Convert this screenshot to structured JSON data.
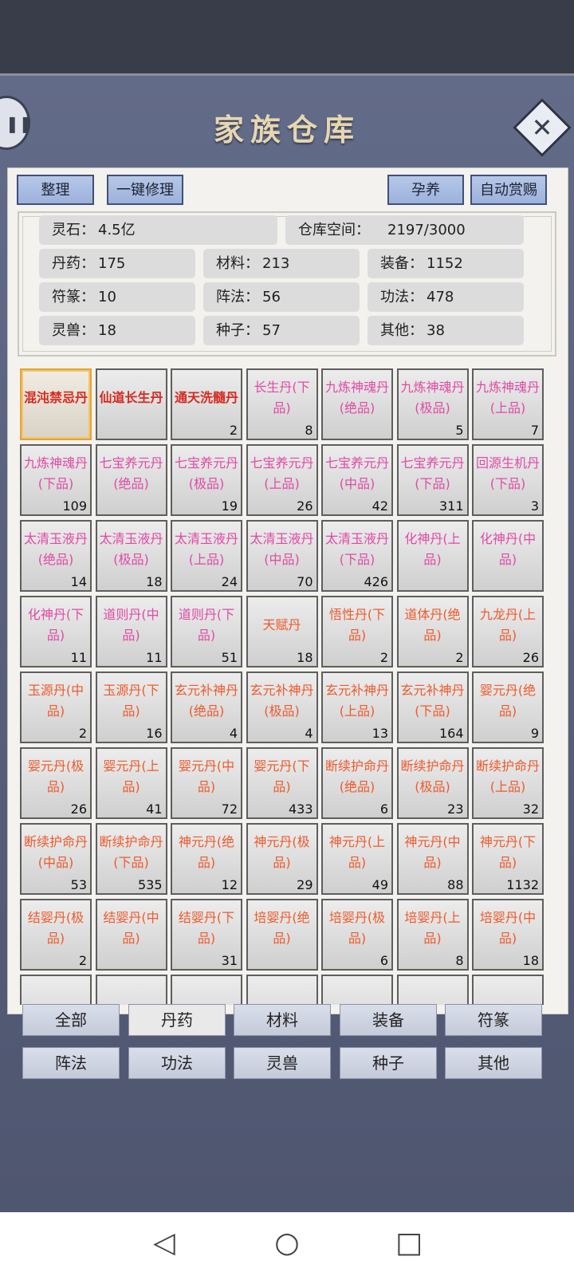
{
  "title": "家族仓库",
  "toolbar": {
    "sort_label": "整理",
    "repair_label": "一键修理",
    "nurture_label": "孕养",
    "auto_reward_label": "自动赏赐"
  },
  "stats": {
    "spirit_stone_label": "灵石：",
    "spirit_stone_value": "4.5亿",
    "storage_label": "仓库空间：",
    "storage_value": "2197/3000",
    "pill_label": "丹药：",
    "pill_value": "175",
    "material_label": "材料：",
    "material_value": "213",
    "equipment_label": "装备：",
    "equipment_value": "1152",
    "talisman_label": "符篆：",
    "talisman_value": "10",
    "formation_label": "阵法：",
    "formation_value": "56",
    "technique_label": "功法：",
    "technique_value": "478",
    "beast_label": "灵兽：",
    "beast_value": "18",
    "seed_label": "种子：",
    "seed_value": "57",
    "other_label": "其他：",
    "other_value": "38"
  },
  "colors": {
    "red": "#d42a20",
    "pink": "#e04aa6",
    "orange": "#ee5a2c"
  },
  "items": [
    {
      "name": "混沌禁忌丹",
      "count": "",
      "color": "red",
      "selected": true
    },
    {
      "name": "仙道长生丹",
      "count": "",
      "color": "red"
    },
    {
      "name": "通天洗髓丹",
      "count": "2",
      "color": "red"
    },
    {
      "name": "长生丹(下品)",
      "count": "8",
      "color": "pink"
    },
    {
      "name": "九炼神魂丹(绝品)",
      "count": "",
      "color": "pink"
    },
    {
      "name": "九炼神魂丹(极品)",
      "count": "5",
      "color": "pink"
    },
    {
      "name": "九炼神魂丹(上品)",
      "count": "7",
      "color": "pink"
    },
    {
      "name": "九炼神魂丹(下品)",
      "count": "109",
      "color": "pink"
    },
    {
      "name": "七宝养元丹(绝品)",
      "count": "",
      "color": "pink"
    },
    {
      "name": "七宝养元丹(极品)",
      "count": "19",
      "color": "pink"
    },
    {
      "name": "七宝养元丹(上品)",
      "count": "26",
      "color": "pink"
    },
    {
      "name": "七宝养元丹(中品)",
      "count": "42",
      "color": "pink"
    },
    {
      "name": "七宝养元丹(下品)",
      "count": "311",
      "color": "pink"
    },
    {
      "name": "回源生机丹(下品)",
      "count": "3",
      "color": "pink"
    },
    {
      "name": "太清玉液丹(绝品)",
      "count": "14",
      "color": "pink"
    },
    {
      "name": "太清玉液丹(极品)",
      "count": "18",
      "color": "pink"
    },
    {
      "name": "太清玉液丹(上品)",
      "count": "24",
      "color": "pink"
    },
    {
      "name": "太清玉液丹(中品)",
      "count": "70",
      "color": "pink"
    },
    {
      "name": "太清玉液丹(下品)",
      "count": "426",
      "color": "pink"
    },
    {
      "name": "化神丹(上品)",
      "count": "",
      "color": "pink"
    },
    {
      "name": "化神丹(中品)",
      "count": "",
      "color": "pink"
    },
    {
      "name": "化神丹(下品)",
      "count": "11",
      "color": "pink"
    },
    {
      "name": "道则丹(中品)",
      "count": "11",
      "color": "pink"
    },
    {
      "name": "道则丹(下品)",
      "count": "51",
      "color": "pink"
    },
    {
      "name": "天赋丹",
      "count": "18",
      "color": "orange"
    },
    {
      "name": "悟性丹(下品)",
      "count": "2",
      "color": "orange"
    },
    {
      "name": "道体丹(绝品)",
      "count": "2",
      "color": "orange"
    },
    {
      "name": "九龙丹(上品)",
      "count": "26",
      "color": "orange"
    },
    {
      "name": "玉源丹(中品)",
      "count": "2",
      "color": "orange"
    },
    {
      "name": "玉源丹(下品)",
      "count": "16",
      "color": "orange"
    },
    {
      "name": "玄元补神丹(绝品)",
      "count": "4",
      "color": "orange"
    },
    {
      "name": "玄元补神丹(极品)",
      "count": "4",
      "color": "orange"
    },
    {
      "name": "玄元补神丹(上品)",
      "count": "13",
      "color": "orange"
    },
    {
      "name": "玄元补神丹(下品)",
      "count": "164",
      "color": "orange"
    },
    {
      "name": "婴元丹(绝品)",
      "count": "9",
      "color": "orange"
    },
    {
      "name": "婴元丹(极品)",
      "count": "26",
      "color": "orange"
    },
    {
      "name": "婴元丹(上品)",
      "count": "41",
      "color": "orange"
    },
    {
      "name": "婴元丹(中品)",
      "count": "72",
      "color": "orange"
    },
    {
      "name": "婴元丹(下品)",
      "count": "433",
      "color": "orange"
    },
    {
      "name": "断续护命丹(绝品)",
      "count": "6",
      "color": "orange"
    },
    {
      "name": "断续护命丹(极品)",
      "count": "23",
      "color": "orange"
    },
    {
      "name": "断续护命丹(上品)",
      "count": "32",
      "color": "orange"
    },
    {
      "name": "断续护命丹(中品)",
      "count": "53",
      "color": "orange"
    },
    {
      "name": "断续护命丹(下品)",
      "count": "535",
      "color": "orange"
    },
    {
      "name": "神元丹(绝品)",
      "count": "12",
      "color": "orange"
    },
    {
      "name": "神元丹(极品)",
      "count": "29",
      "color": "orange"
    },
    {
      "name": "神元丹(上品)",
      "count": "49",
      "color": "orange"
    },
    {
      "name": "神元丹(中品)",
      "count": "88",
      "color": "orange"
    },
    {
      "name": "神元丹(下品)",
      "count": "1132",
      "color": "orange"
    },
    {
      "name": "结婴丹(极品)",
      "count": "2",
      "color": "orange"
    },
    {
      "name": "结婴丹(中品)",
      "count": "",
      "color": "orange"
    },
    {
      "name": "结婴丹(下品)",
      "count": "31",
      "color": "orange"
    },
    {
      "name": "培婴丹(绝品)",
      "count": "",
      "color": "orange"
    },
    {
      "name": "培婴丹(极品)",
      "count": "6",
      "color": "orange"
    },
    {
      "name": "培婴丹(上品)",
      "count": "8",
      "color": "orange"
    },
    {
      "name": "培婴丹(中品)",
      "count": "18",
      "color": "orange"
    }
  ],
  "categories": [
    "全部",
    "丹药",
    "材料",
    "装备",
    "符篆",
    "阵法",
    "功法",
    "灵兽",
    "种子",
    "其他"
  ],
  "active_category": "丹药",
  "nav": {
    "back_icon": "◁",
    "home_icon": "○",
    "recent_icon": "□"
  }
}
